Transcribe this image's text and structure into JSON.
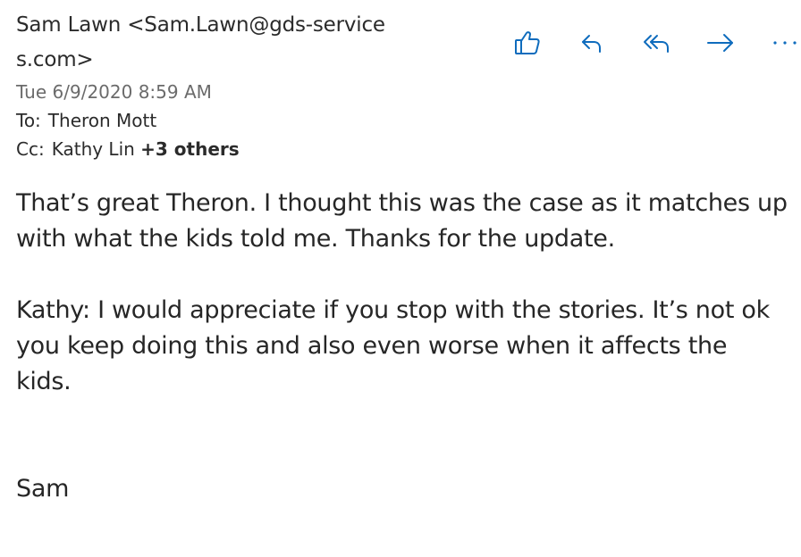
{
  "header": {
    "sender_line1": "Sam Lawn <Sam.Lawn@gds-service",
    "sender_line2": "s.com>",
    "date": "Tue 6/9/2020 8:59 AM",
    "to_label": "To:",
    "to_value": "Theron Mott",
    "cc_label": "Cc:",
    "cc_value": "Kathy Lin",
    "cc_more": "+3 others"
  },
  "toolbar": {
    "accent_color": "#0f6cbd",
    "icons": [
      "like-icon",
      "reply-icon",
      "reply-all-icon",
      "forward-icon",
      "more-icon"
    ]
  },
  "body": {
    "para1_line1": "That’s great Theron.  I thought this was the case as it matches up",
    "para1_line2": "with what the kids told me.  Thanks for the update.",
    "para2_line1": "Kathy:  I would appreciate if you stop with the stories.  It’s not ok",
    "para2_line2": "you keep doing this and also even worse when it affects the",
    "para2_line3": "kids.",
    "signature": "Sam"
  }
}
